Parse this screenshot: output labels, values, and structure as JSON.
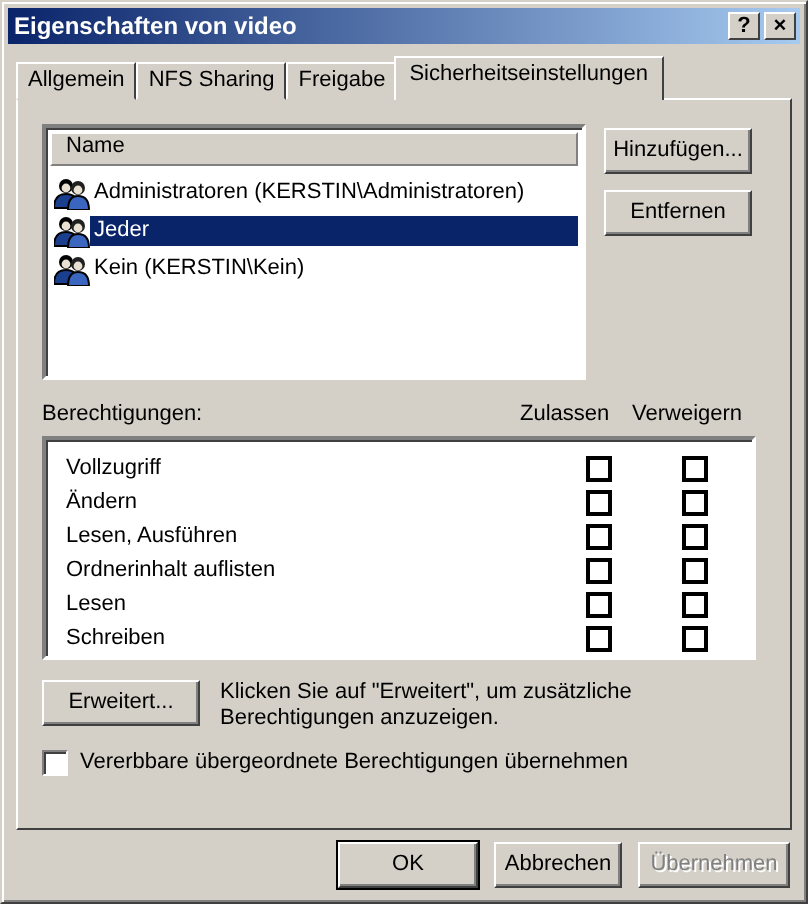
{
  "window": {
    "title": "Eigenschaften von video",
    "help_button": "?",
    "close_button": "×"
  },
  "tabs": [
    {
      "label": "Allgemein",
      "selected": false
    },
    {
      "label": "NFS Sharing",
      "selected": false
    },
    {
      "label": "Freigabe",
      "selected": false
    },
    {
      "label": "Sicherheitseinstellungen",
      "selected": true
    }
  ],
  "users": {
    "column": "Name",
    "items": [
      {
        "name": "Administratoren (KERSTIN\\Administratoren)",
        "selected": false
      },
      {
        "name": "Jeder",
        "selected": true
      },
      {
        "name": "Kein (KERSTIN\\Kein)",
        "selected": false
      }
    ]
  },
  "user_buttons": [
    {
      "label": "Hinzufügen..."
    },
    {
      "label": "Entfernen"
    }
  ],
  "permissions": {
    "label": "Berechtigungen:",
    "allow_label": "Zulassen",
    "deny_label": "Verweigern",
    "rows": [
      {
        "name": "Vollzugriff",
        "allow": false,
        "deny": false
      },
      {
        "name": "Ändern",
        "allow": false,
        "deny": false
      },
      {
        "name": "Lesen, Ausführen",
        "allow": false,
        "deny": false
      },
      {
        "name": "Ordnerinhalt auflisten",
        "allow": false,
        "deny": false
      },
      {
        "name": "Lesen",
        "allow": false,
        "deny": false
      },
      {
        "name": "Schreiben",
        "allow": false,
        "deny": false
      }
    ]
  },
  "advanced": {
    "button": "Erweitert...",
    "hint": "Klicken Sie auf \"Erweitert\", um zusätzliche Berechtigungen anzuzeigen."
  },
  "inherit": {
    "label": "Vererbbare übergeordnete Berechtigungen übernehmen",
    "checked": false
  },
  "buttons": [
    {
      "label": "OK",
      "disabled": false,
      "default": true
    },
    {
      "label": "Abbrechen",
      "disabled": false,
      "default": false
    },
    {
      "label": "Übernehmen",
      "disabled": true,
      "default": false
    }
  ]
}
